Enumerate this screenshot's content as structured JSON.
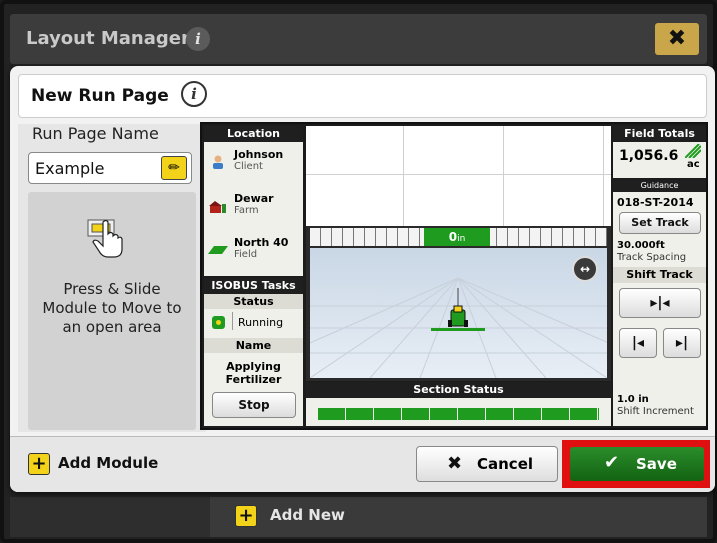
{
  "window": {
    "title": "Layout Manager",
    "close_label": "✖"
  },
  "dialog": {
    "title": "New Run Page",
    "run_page_name_label": "Run Page Name",
    "run_page_name_value": "Example",
    "hint_line1": "Press & Slide",
    "hint_line2": "Module to Move to",
    "hint_line3": "an open area"
  },
  "location": {
    "header": "Location",
    "client_name": "Johnson",
    "client_label": "Client",
    "farm_name": "Dewar",
    "farm_label": "Farm",
    "field_name": "North 40",
    "field_label": "Field"
  },
  "isobus": {
    "header": "ISOBUS Tasks",
    "status_label": "Status",
    "status_value": "Running",
    "name_label": "Name",
    "name_value_1": "Applying",
    "name_value_2": "Fertilizer",
    "stop_label": "Stop"
  },
  "guidance_view": {
    "lightbar_value": "0",
    "lightbar_unit": "in"
  },
  "section_status": {
    "label": "Section Status",
    "segments": 10
  },
  "field_totals": {
    "header": "Field Totals",
    "value": "1,056.6",
    "unit": "ac"
  },
  "guidance": {
    "header": "Guidance",
    "track_name": "018-ST-2014",
    "set_track_label": "Set Track",
    "track_spacing_value": "30.000ft",
    "track_spacing_label": "Track Spacing",
    "shift_track_label": "Shift Track",
    "shift_increment_value": "1.0 in",
    "shift_increment_label": "Shift Increment"
  },
  "footer": {
    "add_module_label": "Add Module",
    "cancel_label": "Cancel",
    "save_label": "Save"
  },
  "background": {
    "add_new_label": "Add New"
  },
  "colors": {
    "jd_green": "#1f9b1f",
    "jd_yellow": "#f2d31a",
    "highlight_red": "#e01010"
  }
}
